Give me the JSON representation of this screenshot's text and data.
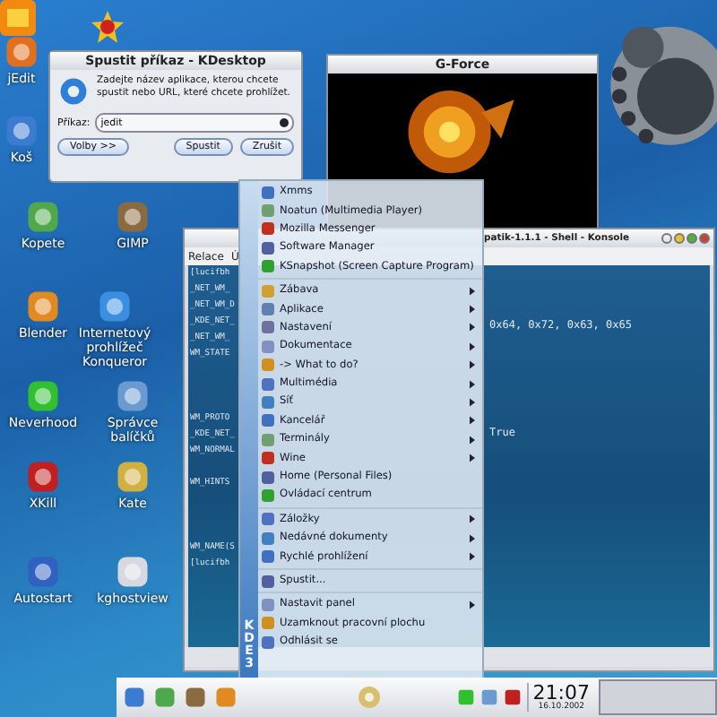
{
  "desktop_icons": [
    {
      "label": "jEdit"
    },
    {
      "label": "Koš"
    },
    {
      "label": "Kopete"
    },
    {
      "label": "GIMP"
    },
    {
      "label": "Blender"
    },
    {
      "label": "Internetový prohlížeč Konqueror"
    },
    {
      "label": "Neverhood"
    },
    {
      "label": "Správce balíčků"
    },
    {
      "label": "XKill"
    },
    {
      "label": "Kate"
    },
    {
      "label": "Autostart"
    },
    {
      "label": "kghostview"
    }
  ],
  "run_dialog": {
    "title": "Spustit příkaz - KDesktop",
    "message": "Zadejte název aplikace, kterou chcete spustit nebo URL, které chcete prohlížet.",
    "command_label": "Příkaz:",
    "command_value": "jedit",
    "buttons": [
      "Volby >>",
      "Spustit",
      "Zrušit"
    ]
  },
  "gforce_window": {
    "title": "G-Force"
  },
  "konsole": {
    "title": "patik-1.1.1 - Shell - Konsole",
    "menu": [
      "Relace",
      "Ú"
    ],
    "left_lines": [
      "[lucifbh",
      "_NET_WM_",
      "_NET_WM_D",
      "_KDE_NET_",
      "_NET_WM_",
      "WM_STATE",
      "WM_PROTO",
      "_KDE_NET_",
      "WM_NORMAL",
      "WM_HINTS",
      "WM_NAME(S",
      "[lucifbh"
    ],
    "right_lines": [
      "0x64, 0x72, 0x63, 0x65",
      "True"
    ]
  },
  "kde_menu": {
    "side_label": "KDE 3",
    "sections": [
      [
        {
          "label": "Xmms",
          "submenu": false
        },
        {
          "label": "Noatun (Multimedia Player)",
          "submenu": false
        },
        {
          "label": "Mozilla Messenger",
          "submenu": false
        },
        {
          "label": "Software Manager",
          "submenu": false
        },
        {
          "label": "KSnapshot (Screen Capture Program)",
          "submenu": false
        }
      ],
      [
        {
          "label": "Zábava",
          "submenu": true
        },
        {
          "label": "Aplikace",
          "submenu": true
        },
        {
          "label": "Nastavení",
          "submenu": true
        },
        {
          "label": "Dokumentace",
          "submenu": true
        },
        {
          "label": "-> What to do?",
          "submenu": true
        },
        {
          "label": "Multimédia",
          "submenu": true
        },
        {
          "label": "Síť",
          "submenu": true
        },
        {
          "label": "Kancelář",
          "submenu": true
        },
        {
          "label": "Terminály",
          "submenu": true
        },
        {
          "label": "Wine",
          "submenu": true
        },
        {
          "label": "Home (Personal Files)",
          "submenu": false
        },
        {
          "label": "Ovládací centrum",
          "submenu": false
        }
      ],
      [
        {
          "label": "Záložky",
          "submenu": true
        },
        {
          "label": "Nedávné dokumenty",
          "submenu": true
        },
        {
          "label": "Rychlé prohlížení",
          "submenu": true
        }
      ],
      [
        {
          "label": "Spustit...",
          "submenu": false
        }
      ],
      [
        {
          "label": "Nastavit panel",
          "submenu": true
        },
        {
          "label": "Uzamknout pracovní plochu",
          "submenu": false
        },
        {
          "label": "Odhlásit se",
          "submenu": false
        }
      ]
    ]
  },
  "taskbar": {
    "clock": "21:07",
    "date": "16.10.2002"
  }
}
